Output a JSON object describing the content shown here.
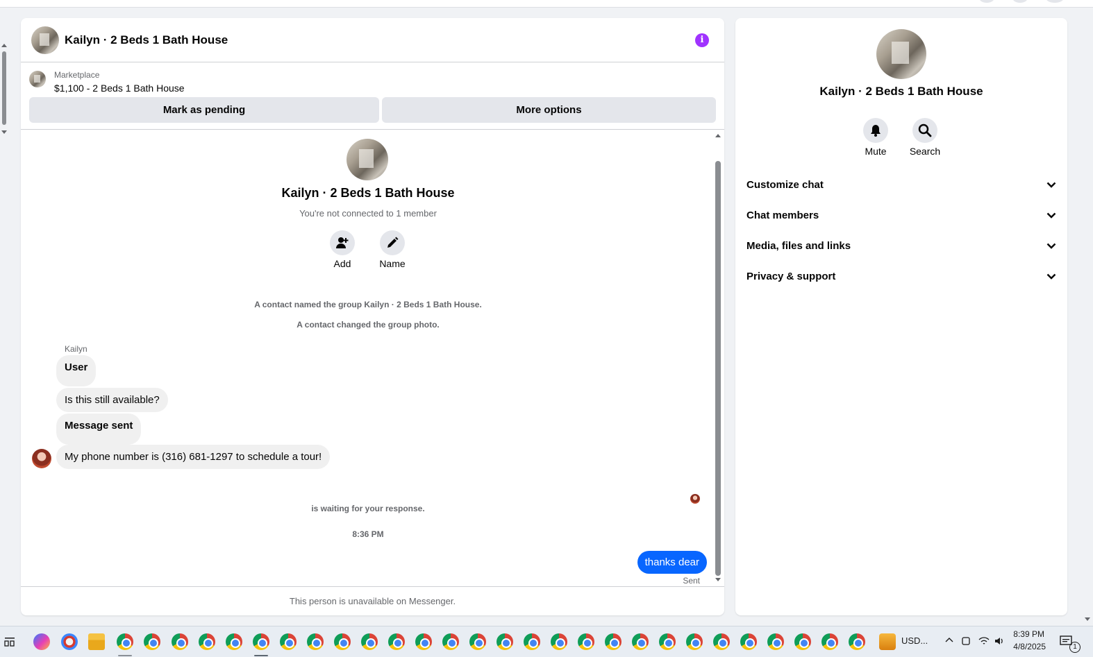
{
  "chat": {
    "title": "Kailyn · 2 Beds 1 Bath House",
    "marketplace_label": "Marketplace",
    "listing": "$1,100 - 2 Beds 1 Bath House",
    "mark_pending_label": "Mark as pending",
    "more_options_label": "More options",
    "group_title": "Kailyn · 2 Beds 1 Bath House",
    "group_subtitle": "You're not connected to 1 member",
    "add_label": "Add",
    "name_label": "Name",
    "sys_msg_1": "A contact named the group Kailyn · 2 Beds 1 Bath House.",
    "sys_msg_2": "A contact changed the group photo.",
    "messages": [
      {
        "sender": "Kailyn",
        "text": "User",
        "bold": true
      },
      {
        "text": "Is this still available?",
        "bold": false
      },
      {
        "text": "Message sent",
        "bold": true
      },
      {
        "text": "My phone number is (316) 681-1297 to schedule a tour!",
        "bold": false
      }
    ],
    "waiting": "is waiting for your response.",
    "time": "8:36 PM",
    "my_message": "thanks dear",
    "sent_status": "Sent",
    "footer": "This person is unavailable on Messenger."
  },
  "side": {
    "title": "Kailyn · 2 Beds 1 Bath House",
    "mute_label": "Mute",
    "search_label": "Search",
    "sections": [
      "Customize chat",
      "Chat members",
      "Media, files and links",
      "Privacy & support"
    ]
  },
  "taskbar": {
    "tray_text": "USD...",
    "clock_time": "8:39 PM",
    "clock_date": "4/8/2025",
    "notif_count": "1"
  },
  "colors": {
    "accent": "#0866ff",
    "info": "#a033ff",
    "bubble": "#f0f0f0"
  }
}
